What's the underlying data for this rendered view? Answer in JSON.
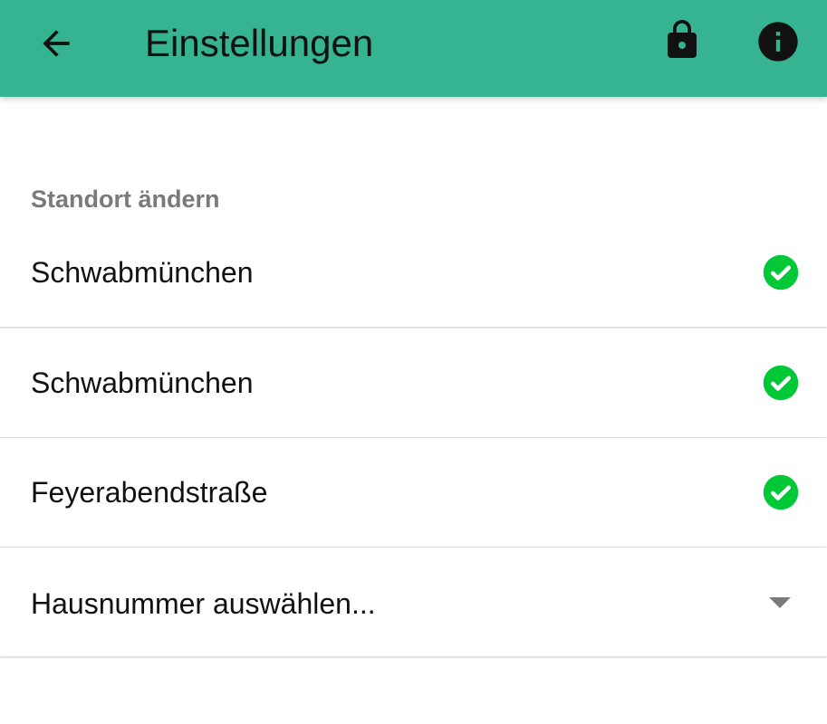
{
  "appbar": {
    "title": "Einstellungen",
    "back_icon": "arrow-back-icon",
    "lock_icon": "lock-icon",
    "info_icon": "info-icon",
    "color": "#36b491"
  },
  "section": {
    "header": "Standort ändern"
  },
  "rows": [
    {
      "label": "Schwabmünchen",
      "status_icon": "check-circle-icon"
    },
    {
      "label": "Schwabmünchen",
      "status_icon": "check-circle-icon"
    },
    {
      "label": "Feyerabendstraße",
      "status_icon": "check-circle-icon"
    },
    {
      "label": "Hausnummer auswählen...",
      "status_icon": "dropdown-arrow-icon"
    }
  ],
  "colors": {
    "check": "#00c837",
    "header_text": "#7a7a7a"
  }
}
